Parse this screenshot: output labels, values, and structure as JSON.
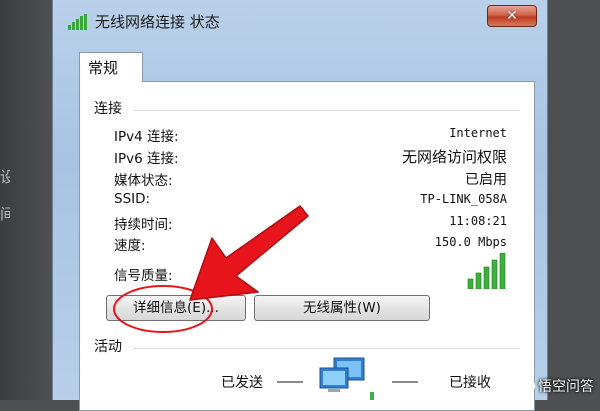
{
  "window": {
    "title": "无线网络连接 状态",
    "close_label": "✕"
  },
  "tabs": [
    {
      "label": "常规",
      "selected": true
    }
  ],
  "connection": {
    "section_label": "连接",
    "rows": [
      {
        "label": "IPv4 连接:",
        "value": "Internet"
      },
      {
        "label": "IPv6 连接:",
        "value": "无网络访问权限"
      },
      {
        "label": "媒体状态:",
        "value": "已启用"
      },
      {
        "label": "SSID:",
        "value": "TP-LINK_058A"
      },
      {
        "label": "持续时间:",
        "value": "11:08:21"
      },
      {
        "label": "速度:",
        "value": "150.0 Mbps"
      }
    ],
    "signal_label": "信号质量:",
    "signal_bars": 5,
    "signal_icon": "signal-strength-icon"
  },
  "buttons": {
    "details": "详细信息(E)...",
    "wireless_properties": "无线属性(W)"
  },
  "activity": {
    "section_label": "活动",
    "sent_label": "已发送",
    "received_label": "已接收",
    "icon": "network-computers-icon"
  },
  "backdrop": {
    "glyph_top": "设",
    "glyph_bottom": "间"
  },
  "watermark": {
    "text": "悟空问答"
  },
  "colors": {
    "annotation_red": "#e8141b",
    "signal_green": "#3db03d"
  }
}
